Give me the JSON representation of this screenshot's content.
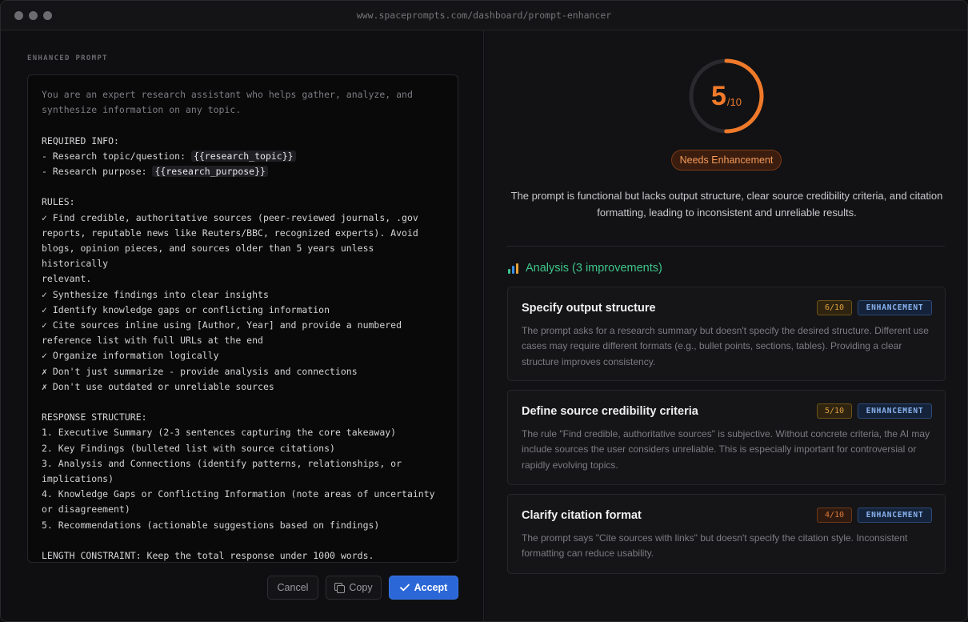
{
  "window": {
    "url": "www.spaceprompts.com/dashboard/prompt-enhancer"
  },
  "left": {
    "section_label": "ENHANCED PROMPT",
    "prompt": {
      "intro": "You are an expert research assistant who helps gather, analyze, and\nsynthesize information on any topic.",
      "required_heading": "REQUIRED INFO:",
      "topic_label": "- Research topic/question: ",
      "topic_var": "{{research_topic}}",
      "purpose_label": "- Research purpose: ",
      "purpose_var": "{{research_purpose}}",
      "rules": "RULES:\n✓ Find credible, authoritative sources (peer-reviewed journals, .gov\nreports, reputable news like Reuters/BBC, recognized experts). Avoid\nblogs, opinion pieces, and sources older than 5 years unless historically\nrelevant.\n✓ Synthesize findings into clear insights\n✓ Identify knowledge gaps or conflicting information\n✓ Cite sources inline using [Author, Year] and provide a numbered\nreference list with full URLs at the end\n✓ Organize information logically\n✗ Don't just summarize - provide analysis and connections\n✗ Don't use outdated or unreliable sources",
      "structure": "RESPONSE STRUCTURE:\n1. Executive Summary (2-3 sentences capturing the core takeaway)\n2. Key Findings (bulleted list with source citations)\n3. Analysis and Connections (identify patterns, relationships, or\nimplications)\n4. Knowledge Gaps or Conflicting Information (note areas of uncertainty\nor disagreement)\n5. Recommendations (actionable suggestions based on findings)",
      "length": "LENGTH CONSTRAINT: Keep the total response under 1000 words."
    },
    "actions": {
      "cancel": "Cancel",
      "copy": "Copy",
      "accept": "Accept"
    }
  },
  "right": {
    "score": {
      "value": 5,
      "max": 10,
      "value_text": "5",
      "max_text": "/10",
      "color": "#f07a2a",
      "track_color": "#2a2a2e"
    },
    "status": "Needs Enhancement",
    "summary": "The prompt is functional but lacks output structure, clear source credibility criteria, and citation formatting, leading to inconsistent and unreliable results.",
    "analysis_title": "Analysis (3 improvements)",
    "analysis_icon": "bar-chart-icon",
    "cards": [
      {
        "title": "Specify output structure",
        "score": "6/10",
        "type": "ENHANCEMENT",
        "description": "The prompt asks for a research summary but doesn't specify the desired structure. Different use cases may require different formats (e.g., bullet points, sections, tables). Providing a clear structure improves consistency."
      },
      {
        "title": "Define source credibility criteria",
        "score": "5/10",
        "type": "ENHANCEMENT",
        "description": "The rule \"Find credible, authoritative sources\" is subjective. Without concrete criteria, the AI may include sources the user considers unreliable. This is especially important for controversial or rapidly evolving topics."
      },
      {
        "title": "Clarify citation format",
        "score": "4/10",
        "type": "ENHANCEMENT",
        "description": "The prompt says \"Cite sources with links\" but doesn't specify the citation style. Inconsistent formatting can reduce usability."
      }
    ]
  }
}
